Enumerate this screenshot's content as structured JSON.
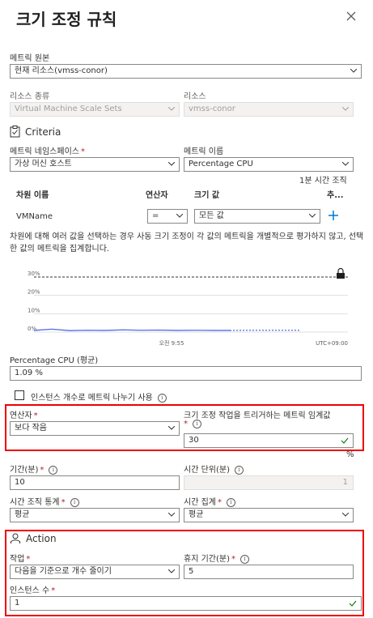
{
  "panel": {
    "title": "크기 조정 규칙"
  },
  "metric_source": {
    "label": "메트릭 원본",
    "value": "현재 리소스(vmss-conor)"
  },
  "resource_type": {
    "label": "리소스 종류",
    "value": "Virtual Machine Scale Sets"
  },
  "resource": {
    "label": "리소스",
    "value": "vmss-conor"
  },
  "criteria": {
    "title": "Criteria"
  },
  "metric_namespace": {
    "label": "메트릭 네임스페이스",
    "value": "가상 머신 호스트"
  },
  "metric_name": {
    "label": "메트릭 이름",
    "value": "Percentage CPU"
  },
  "time_grain_note": "1분 시간 조직",
  "dimensions": {
    "headers": {
      "name": "차원 이름",
      "operator": "연산자",
      "value": "크기 값",
      "more": "추..."
    },
    "row": {
      "name": "VMName",
      "operator": "=",
      "value": "모든 값"
    }
  },
  "dimension_note": "차원에 대해 여러 값을 선택하는 경우 사동 크기 조정이 각 값의 메트릭을 개별적으로 평가하지 않고, 선택한 값의 메트릭을 집계합니다.",
  "chart_data": {
    "type": "line",
    "y_ticks": [
      "30%",
      "20%",
      "10%",
      "0%"
    ],
    "ylim": [
      0,
      30
    ],
    "threshold": 30,
    "x_labels": [
      "오전 9:55",
      "UTC+09:00"
    ],
    "series": [
      {
        "values": [
          0.9,
          1.6,
          0.8,
          1.0,
          0.9,
          1.2,
          1.0,
          1.1,
          0.9,
          1.0,
          0.9,
          0.9,
          1.0,
          1.0,
          1.0,
          1.0
        ]
      }
    ],
    "grid": true
  },
  "metric_summary": {
    "label": "Percentage CPU (평균)",
    "value": "1.09 %"
  },
  "divide_by_instance": {
    "label": "인스턴스 개수로 메트릭 나누기 사용"
  },
  "operator": {
    "label": "연산자",
    "value": "보다 작음"
  },
  "threshold": {
    "label": "크기 조정 작업을 트리거하는 메트릭 임계값",
    "value": "30",
    "unit": "%"
  },
  "duration": {
    "label": "기간(분)",
    "value": "10"
  },
  "time_grain": {
    "label": "시간 단위(분)",
    "value": "1"
  },
  "time_grain_stat": {
    "label": "시간 조직 통계",
    "value": "평균"
  },
  "time_aggregation": {
    "label": "시간 집계",
    "value": "평균"
  },
  "action": {
    "title": "Action"
  },
  "operation": {
    "label": "작업",
    "value": "다음을 기준으로 개수 줄이기"
  },
  "cooldown": {
    "label": "휴지 기간(분)",
    "value": "5"
  },
  "instance_count": {
    "label": "인스턴스 수",
    "value": "1"
  },
  "colors": {
    "accent": "#0078d4",
    "highlight": "#e00000",
    "success": "#107c10",
    "line": "#4f6bed"
  }
}
